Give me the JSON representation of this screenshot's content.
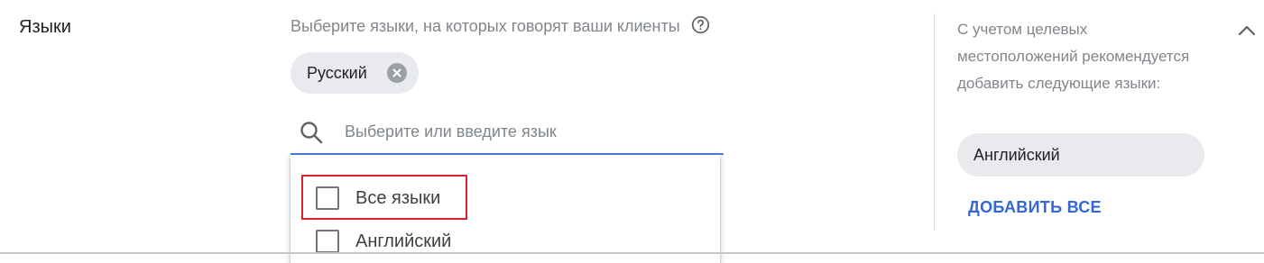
{
  "section": {
    "title": "Языки"
  },
  "languages": {
    "hint": "Выберите языки, на которых говорят ваши клиенты",
    "help_icon": "help-circle-icon",
    "selected_chips": [
      {
        "label": "Русский"
      }
    ],
    "search": {
      "placeholder": "Выберите или введите язык",
      "value": ""
    },
    "dropdown": {
      "options": [
        {
          "label": "Все языки",
          "checked": false
        },
        {
          "label": "Английский",
          "checked": false
        }
      ]
    }
  },
  "recommendations": {
    "text": "С учетом целевых местоположений рекомендуется добавить следующие языки:",
    "chips": [
      {
        "label": "Английский"
      }
    ],
    "add_all_label": "ДОБАВИТЬ ВСЕ"
  },
  "colors": {
    "accent": "#3367d6",
    "focus_line": "#4a7fd4",
    "highlight": "#d9232e",
    "chip_bg": "#e8eaed"
  }
}
